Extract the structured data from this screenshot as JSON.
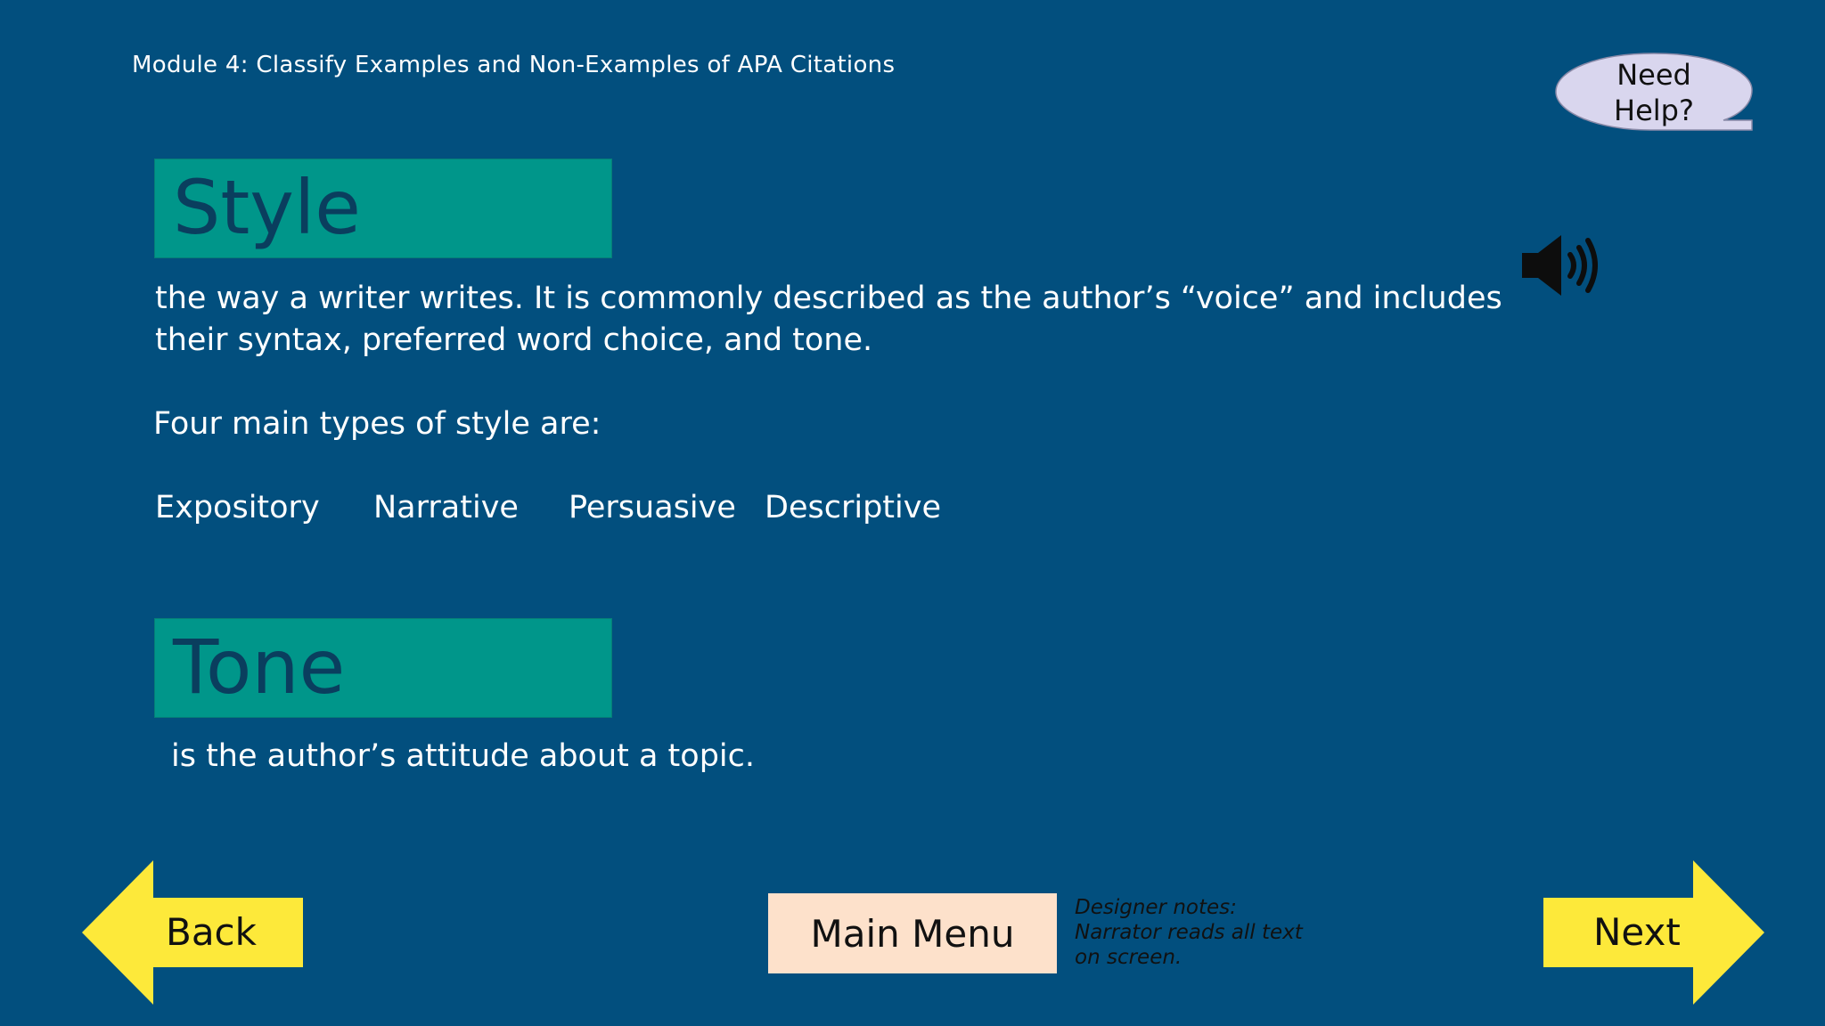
{
  "header": {
    "module_title": "Module 4: Classify Examples and Non-Examples of APA Citations",
    "help_label": "Need\nHelp?"
  },
  "style_section": {
    "heading": "Style",
    "definition_line1": "the way a writer writes. It is commonly described as the author’s “voice” and includes",
    "definition_line2": "their syntax, preferred word choice, and tone.",
    "types_intro": "Four main types of style are:",
    "types": [
      "Expository",
      "Narrative",
      "Persuasive",
      "Descriptive"
    ]
  },
  "tone_section": {
    "heading": "Tone",
    "definition": "is the author’s attitude about a topic."
  },
  "navigation": {
    "back_label": "Back",
    "main_menu_label": "Main Menu",
    "next_label": "Next"
  },
  "designer_notes": {
    "text": "Designer notes:\nNarrator reads all text\non screen."
  },
  "icons": {
    "audio": "speaker-icon",
    "back": "left-arrow-icon",
    "next": "right-arrow-icon"
  },
  "colors": {
    "background": "#024f7e",
    "heading_box": "#00968a",
    "heading_text": "#0a3e5e",
    "arrow": "#fde93a",
    "menu_button": "#fde1cb",
    "help_bubble": "#d9d6ee"
  }
}
